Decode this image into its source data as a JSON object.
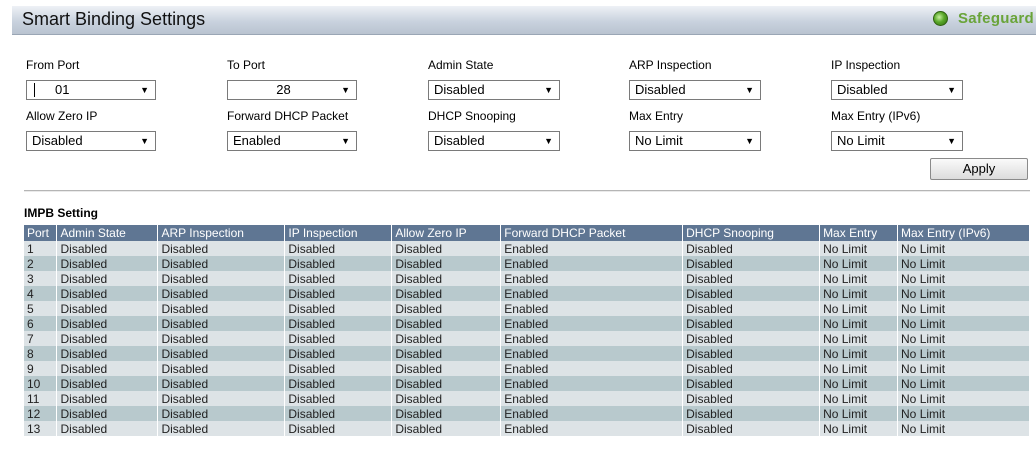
{
  "header": {
    "title": "Smart Binding Settings",
    "safeguard": "Safeguard"
  },
  "form": {
    "from_port": {
      "label": "From Port",
      "value": "01"
    },
    "to_port": {
      "label": "To Port",
      "value": "28"
    },
    "admin_state": {
      "label": "Admin State",
      "value": "Disabled"
    },
    "arp_inspection": {
      "label": "ARP Inspection",
      "value": "Disabled"
    },
    "ip_inspection": {
      "label": "IP Inspection",
      "value": "Disabled"
    },
    "allow_zero_ip": {
      "label": "Allow Zero IP",
      "value": "Disabled"
    },
    "forward_dhcp": {
      "label": "Forward DHCP Packet",
      "value": "Enabled"
    },
    "dhcp_snooping": {
      "label": "DHCP Snooping",
      "value": "Disabled"
    },
    "max_entry": {
      "label": "Max Entry",
      "value": "No Limit"
    },
    "max_entry_ipv6": {
      "label": "Max Entry (IPv6)",
      "value": "No Limit"
    },
    "apply_label": "Apply"
  },
  "table": {
    "section_title": "IMPB Setting",
    "headers": [
      "Port",
      "Admin State",
      "ARP Inspection",
      "IP Inspection",
      "Allow Zero IP",
      "Forward DHCP Packet",
      "DHCP Snooping",
      "Max Entry",
      "Max Entry (IPv6)"
    ],
    "rows": [
      [
        "1",
        "Disabled",
        "Disabled",
        "Disabled",
        "Disabled",
        "Enabled",
        "Disabled",
        "No Limit",
        "No Limit"
      ],
      [
        "2",
        "Disabled",
        "Disabled",
        "Disabled",
        "Disabled",
        "Enabled",
        "Disabled",
        "No Limit",
        "No Limit"
      ],
      [
        "3",
        "Disabled",
        "Disabled",
        "Disabled",
        "Disabled",
        "Enabled",
        "Disabled",
        "No Limit",
        "No Limit"
      ],
      [
        "4",
        "Disabled",
        "Disabled",
        "Disabled",
        "Disabled",
        "Enabled",
        "Disabled",
        "No Limit",
        "No Limit"
      ],
      [
        "5",
        "Disabled",
        "Disabled",
        "Disabled",
        "Disabled",
        "Enabled",
        "Disabled",
        "No Limit",
        "No Limit"
      ],
      [
        "6",
        "Disabled",
        "Disabled",
        "Disabled",
        "Disabled",
        "Enabled",
        "Disabled",
        "No Limit",
        "No Limit"
      ],
      [
        "7",
        "Disabled",
        "Disabled",
        "Disabled",
        "Disabled",
        "Enabled",
        "Disabled",
        "No Limit",
        "No Limit"
      ],
      [
        "8",
        "Disabled",
        "Disabled",
        "Disabled",
        "Disabled",
        "Enabled",
        "Disabled",
        "No Limit",
        "No Limit"
      ],
      [
        "9",
        "Disabled",
        "Disabled",
        "Disabled",
        "Disabled",
        "Enabled",
        "Disabled",
        "No Limit",
        "No Limit"
      ],
      [
        "10",
        "Disabled",
        "Disabled",
        "Disabled",
        "Disabled",
        "Enabled",
        "Disabled",
        "No Limit",
        "No Limit"
      ],
      [
        "11",
        "Disabled",
        "Disabled",
        "Disabled",
        "Disabled",
        "Enabled",
        "Disabled",
        "No Limit",
        "No Limit"
      ],
      [
        "12",
        "Disabled",
        "Disabled",
        "Disabled",
        "Disabled",
        "Enabled",
        "Disabled",
        "No Limit",
        "No Limit"
      ],
      [
        "13",
        "Disabled",
        "Disabled",
        "Disabled",
        "Disabled",
        "Enabled",
        "Disabled",
        "No Limit",
        "No Limit"
      ]
    ]
  },
  "colors": {
    "header_row": "#5f7693",
    "row_light": "#dde3e6",
    "row_dark": "#b8c9cd",
    "safeguard_green": "#6aa43a"
  },
  "icons": {
    "safeguard": "green-dot-icon",
    "dropdown": "triangle-down-icon"
  }
}
